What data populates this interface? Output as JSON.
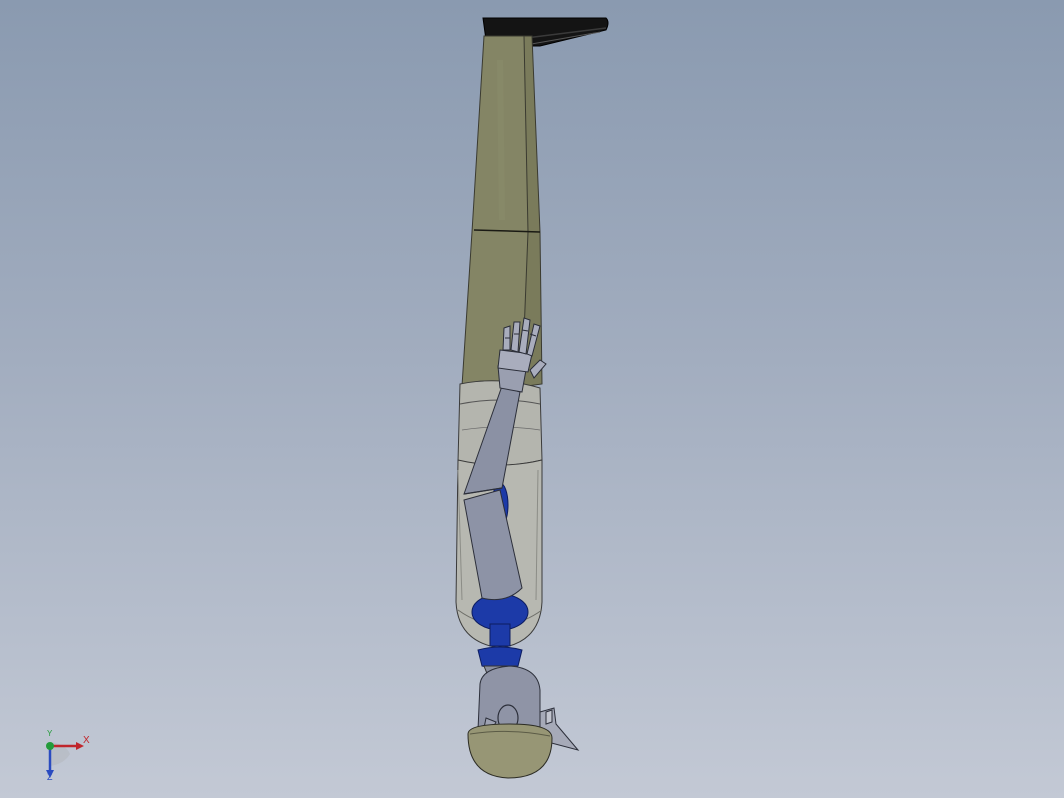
{
  "scene": {
    "model_name": "",
    "orientation": "head-down"
  },
  "triad": {
    "x_label": "X",
    "y_label": "Y",
    "z_label": "Z"
  },
  "colors": {
    "background_top": "#8a9ab0",
    "background_bottom": "#c3c9d5",
    "leg_olive": "#838463",
    "torso_gray": "#b5b6af",
    "arm_gray": "#8d93a6",
    "joint_blue": "#1c3aa8",
    "head_olive": "#979675",
    "shoe_black": "#141414",
    "axis_x": "#c0262c",
    "axis_y": "#239b3a",
    "axis_z": "#2a4bc0"
  }
}
